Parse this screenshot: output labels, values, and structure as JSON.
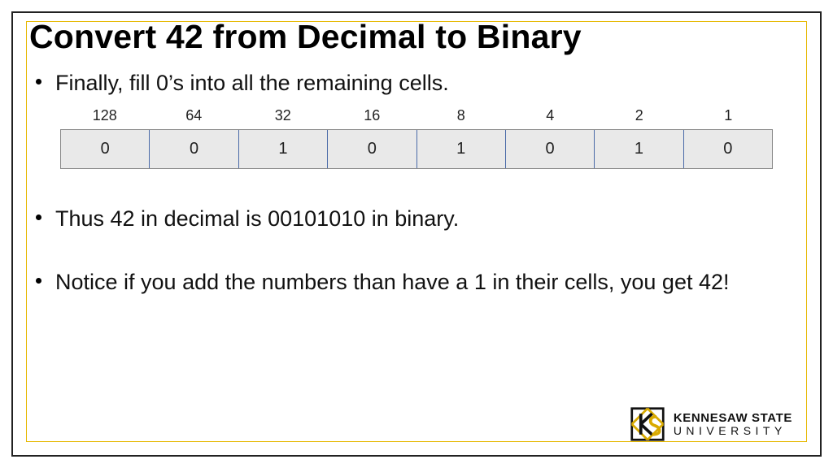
{
  "title": "Convert 42 from Decimal to Binary",
  "bullets": {
    "b1": "Finally, fill 0’s into all the remaining cells.",
    "b2": "Thus 42 in decimal is 00101010 in binary.",
    "b3": "Notice if you add the numbers than have a 1 in their cells, you get 42!"
  },
  "table": {
    "headers": [
      "128",
      "64",
      "32",
      "16",
      "8",
      "4",
      "2",
      "1"
    ],
    "bits": [
      "0",
      "0",
      "1",
      "0",
      "1",
      "0",
      "1",
      "0"
    ]
  },
  "logo": {
    "line1": "KENNESAW STATE",
    "line2": "UNIVERSITY",
    "colors": {
      "gold": "#d9aa00",
      "black": "#111111"
    }
  }
}
